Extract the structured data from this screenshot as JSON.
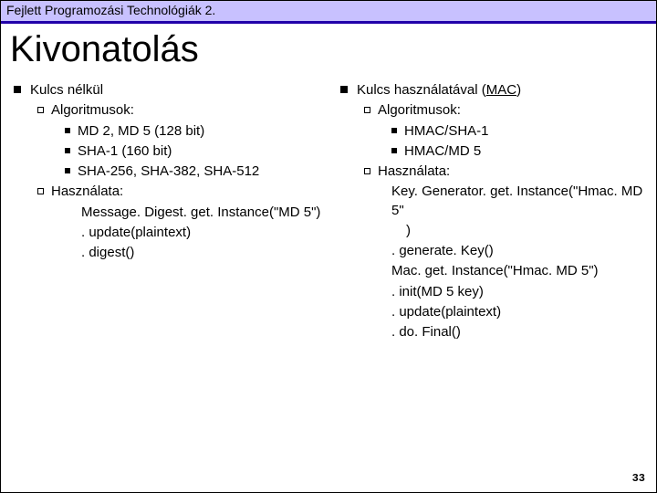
{
  "header": "Fejlett Programozási Technológiák 2.",
  "title": "Kivonatolás",
  "left": {
    "h": "Kulcs nélkül",
    "alg_label": "Algoritmusok:",
    "alg1": "MD 2, MD 5 (128 bit)",
    "alg2": "SHA-1 (160 bit)",
    "alg3": "SHA-256, SHA-382, SHA-512",
    "use_label": "Használata:",
    "u1": "Message. Digest. get. Instance(\"MD 5\")",
    "u2": ". update(plaintext)",
    "u3": ". digest()"
  },
  "right": {
    "h_pre": "Kulcs használatával (",
    "h_mac": "MAC",
    "h_post": ")",
    "alg_label": "Algoritmusok:",
    "alg1": "HMAC/SHA-1",
    "alg2": "HMAC/MD 5",
    "use_label": "Használata:",
    "u1a": "Key. Generator. get. Instance(\"Hmac. MD 5\"",
    "u1b": ")",
    "u2": ". generate. Key()",
    "u3": "Mac. get. Instance(\"Hmac. MD 5\")",
    "u4": ". init(MD 5 key)",
    "u5": ". update(plaintext)",
    "u6": ". do. Final()"
  },
  "page": "33"
}
